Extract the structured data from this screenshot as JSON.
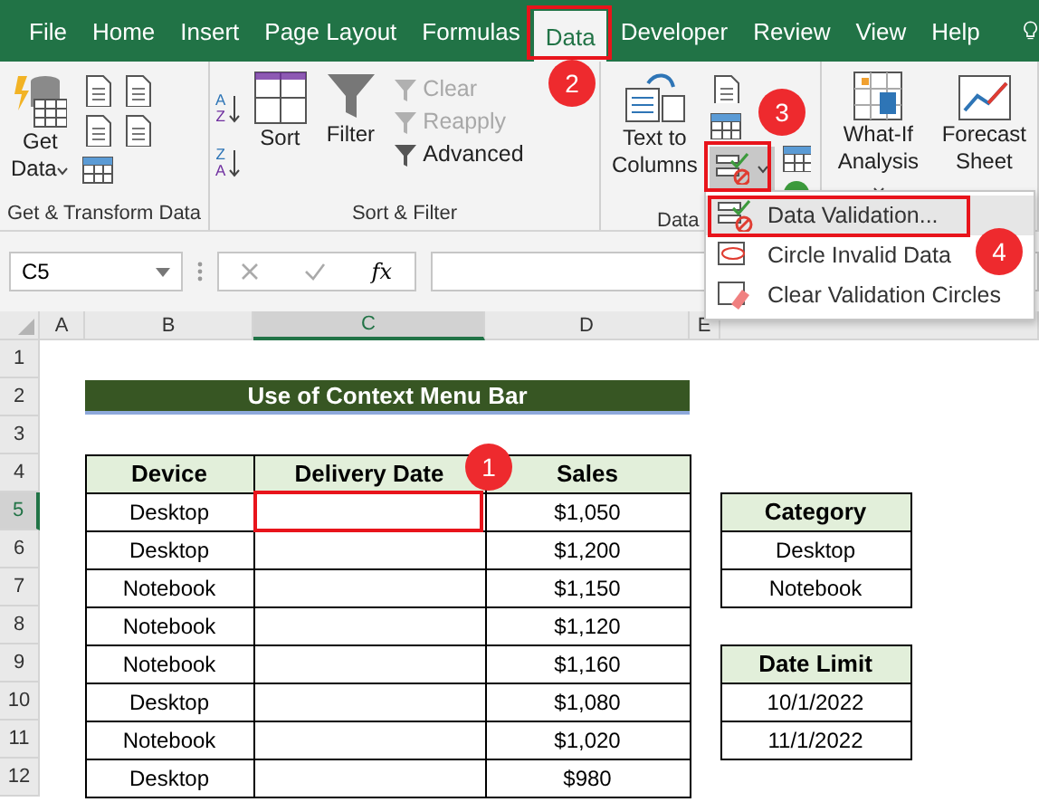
{
  "tabs": [
    {
      "label": "File",
      "selected": false
    },
    {
      "label": "Home",
      "selected": false
    },
    {
      "label": "Insert",
      "selected": false
    },
    {
      "label": "Page Layout",
      "selected": false
    },
    {
      "label": "Formulas",
      "selected": false
    },
    {
      "label": "Data",
      "selected": true
    },
    {
      "label": "Developer",
      "selected": false
    },
    {
      "label": "Review",
      "selected": false
    },
    {
      "label": "View",
      "selected": false
    },
    {
      "label": "Help",
      "selected": false
    }
  ],
  "ribbon": {
    "get_transform": {
      "label": "Get & Transform Data",
      "get_data": [
        "Get",
        "Data"
      ]
    },
    "sort_filter": {
      "label": "Sort & Filter",
      "sort_icons": [
        [
          "A",
          "Z"
        ],
        [
          "Z",
          "A"
        ]
      ],
      "sort": "Sort",
      "filter": "Filter",
      "small_commands": [
        {
          "label": "Clear",
          "disabled": true
        },
        {
          "label": "Reapply",
          "disabled": true
        },
        {
          "label": "Advanced",
          "disabled": false
        }
      ]
    },
    "data_tools": {
      "label": "Data",
      "text_to_columns": [
        "Text to",
        "Columns"
      ]
    },
    "forecast": {
      "what_if": [
        "What-If",
        "Analysis"
      ],
      "forecast_sheet": [
        "Forecast",
        "Sheet"
      ]
    }
  },
  "menu": {
    "items": [
      {
        "label": "Data Validation...",
        "selected": true
      },
      {
        "label": "Circle Invalid Data",
        "selected": false
      },
      {
        "label": "Clear Validation Circles",
        "selected": false
      }
    ]
  },
  "formula_bar": {
    "name_box": "C5",
    "function_label": "fx"
  },
  "columns": [
    {
      "label": "A",
      "selected": false
    },
    {
      "label": "B",
      "selected": false
    },
    {
      "label": "C",
      "selected": true
    },
    {
      "label": "D",
      "selected": false
    },
    {
      "label": "E",
      "selected": false
    }
  ],
  "rows": [
    {
      "label": "1",
      "selected": false
    },
    {
      "label": "2",
      "selected": false
    },
    {
      "label": "3",
      "selected": false
    },
    {
      "label": "4",
      "selected": false
    },
    {
      "label": "5",
      "selected": true
    },
    {
      "label": "6",
      "selected": false
    },
    {
      "label": "7",
      "selected": false
    },
    {
      "label": "8",
      "selected": false
    },
    {
      "label": "9",
      "selected": false
    },
    {
      "label": "10",
      "selected": false
    },
    {
      "label": "11",
      "selected": false
    },
    {
      "label": "12",
      "selected": false
    }
  ],
  "sheet": {
    "title": "Use of Context Menu Bar",
    "table": {
      "columns": [
        "Device",
        "Delivery Date",
        "Sales"
      ],
      "rows": [
        [
          "Desktop",
          "",
          "$1,050"
        ],
        [
          "Desktop",
          "",
          "$1,200"
        ],
        [
          "Notebook",
          "",
          "$1,150"
        ],
        [
          "Notebook",
          "",
          "$1,120"
        ],
        [
          "Notebook",
          "",
          "$1,160"
        ],
        [
          "Desktop",
          "",
          "$1,080"
        ],
        [
          "Notebook",
          "",
          "$1,020"
        ],
        [
          "Desktop",
          "",
          "$980"
        ]
      ]
    },
    "category": {
      "header": "Category",
      "values": [
        "Desktop",
        "Notebook"
      ]
    },
    "date_limit": {
      "header": "Date Limit",
      "values": [
        "10/1/2022",
        "11/1/2022"
      ]
    }
  },
  "annotations": [
    "1",
    "2",
    "3",
    "4"
  ]
}
